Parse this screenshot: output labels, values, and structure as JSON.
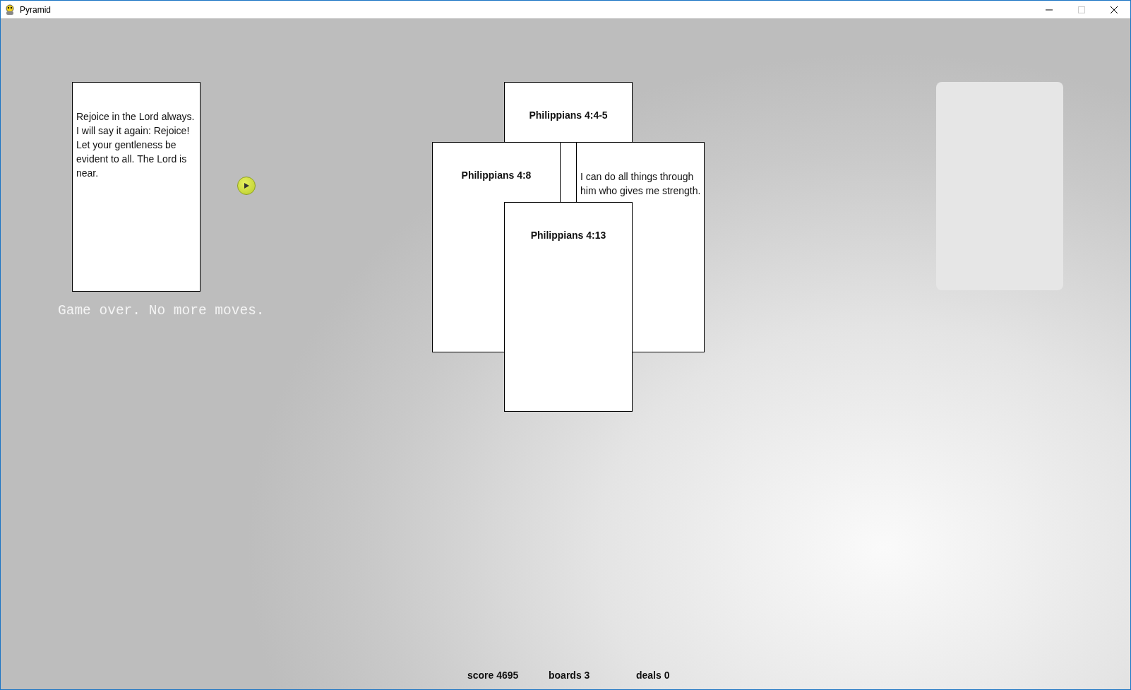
{
  "window": {
    "title": "Pyramid"
  },
  "waste_card": {
    "kind": "verse",
    "text": "Rejoice in the Lord always. I will say it again: Rejoice! Let your gentleness be evident to all. The Lord is near."
  },
  "message": "Game over. No more moves.",
  "pyramid": [
    {
      "kind": "reference",
      "text": "Philippians 4:4-5"
    },
    {
      "kind": "reference",
      "text": "Philippians 4:8"
    },
    {
      "kind": "verse",
      "text": "I can do all things through him who gives me strength."
    },
    {
      "kind": "reference",
      "text": "Philippians 4:13"
    }
  ],
  "status_bar": [
    "score 4695",
    "boards 3",
    "deals 0"
  ]
}
